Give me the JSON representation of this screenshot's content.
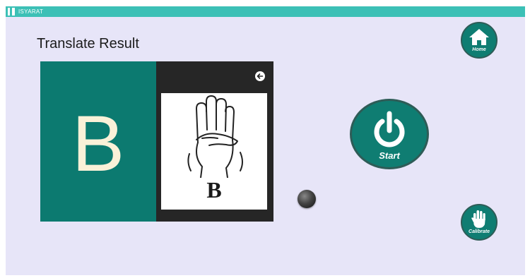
{
  "window": {
    "title": "ISYARAT"
  },
  "page": {
    "heading": "Translate Result"
  },
  "result": {
    "letter": "B",
    "sign_caption": "B"
  },
  "buttons": {
    "start_label": "Start",
    "home_label": "Home",
    "calibrate_label": "Calibrate"
  },
  "icons": {
    "app": "app-icon",
    "back": "back-arrow-icon",
    "power": "power-icon",
    "home": "home-icon",
    "calibrate": "hand-icon",
    "knob": "knob-icon"
  },
  "colors": {
    "titlebar": "#3cc0b6",
    "background": "#e7e5f8",
    "accent": "#0f7d72",
    "letter_tile": "#0c7a70",
    "letter": "#faf1d8"
  }
}
